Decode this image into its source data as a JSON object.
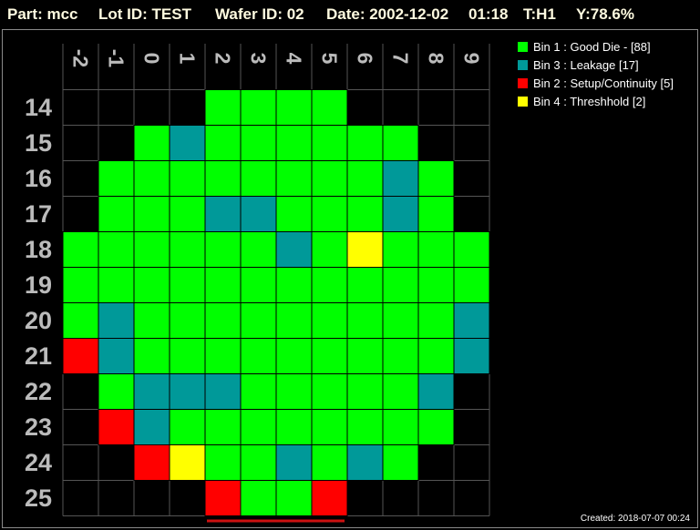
{
  "header": {
    "part": "Part: mcc",
    "lot": "Lot ID: TEST",
    "wafer": "Wafer ID: 02",
    "date": "Date: 2002-12-02",
    "time": "01:18",
    "test": "T:H1",
    "yield": "Y:78.6%"
  },
  "footer": {
    "created": "Created: 2018-07-07 00:24"
  },
  "colors": {
    "bin1": "#00ff00",
    "bin3": "#009999",
    "bin2": "#ff0000",
    "bin4": "#ffff00",
    "grid": "#555555",
    "axis_text": "#bbbbbb",
    "header_text": "#fffbe0"
  },
  "chart_data": {
    "type": "heatmap",
    "x_ticks": [
      "-2",
      "-1",
      "0",
      "1",
      "2",
      "3",
      "4",
      "5",
      "6",
      "7",
      "8",
      "9"
    ],
    "y_ticks": [
      "14",
      "15",
      "16",
      "17",
      "18",
      "19",
      "20",
      "21",
      "22",
      "23",
      "24",
      "25"
    ],
    "legend": [
      {
        "bin": 1,
        "label": "Bin 1 : Good Die - [88]",
        "color": "#00ff00"
      },
      {
        "bin": 3,
        "label": "Bin 3 : Leakage [17]",
        "color": "#009999"
      },
      {
        "bin": 2,
        "label": "Bin 2 : Setup/Continuity [5]",
        "color": "#ff0000"
      },
      {
        "bin": 4,
        "label": "Bin 4 : Threshhold [2]",
        "color": "#ffff00"
      }
    ],
    "legend_position": "top-right",
    "grid": true,
    "notch": "bottom",
    "dies": [
      {
        "x": 2,
        "y": 14,
        "bin": 1
      },
      {
        "x": 3,
        "y": 14,
        "bin": 1
      },
      {
        "x": 4,
        "y": 14,
        "bin": 1
      },
      {
        "x": 5,
        "y": 14,
        "bin": 1
      },
      {
        "x": 0,
        "y": 15,
        "bin": 1
      },
      {
        "x": 1,
        "y": 15,
        "bin": 3
      },
      {
        "x": 2,
        "y": 15,
        "bin": 1
      },
      {
        "x": 3,
        "y": 15,
        "bin": 1
      },
      {
        "x": 4,
        "y": 15,
        "bin": 1
      },
      {
        "x": 5,
        "y": 15,
        "bin": 1
      },
      {
        "x": 6,
        "y": 15,
        "bin": 1
      },
      {
        "x": 7,
        "y": 15,
        "bin": 1
      },
      {
        "x": -1,
        "y": 16,
        "bin": 1
      },
      {
        "x": 0,
        "y": 16,
        "bin": 1
      },
      {
        "x": 1,
        "y": 16,
        "bin": 1
      },
      {
        "x": 2,
        "y": 16,
        "bin": 1
      },
      {
        "x": 3,
        "y": 16,
        "bin": 1
      },
      {
        "x": 4,
        "y": 16,
        "bin": 1
      },
      {
        "x": 5,
        "y": 16,
        "bin": 1
      },
      {
        "x": 6,
        "y": 16,
        "bin": 1
      },
      {
        "x": 7,
        "y": 16,
        "bin": 3
      },
      {
        "x": 8,
        "y": 16,
        "bin": 1
      },
      {
        "x": -1,
        "y": 17,
        "bin": 1
      },
      {
        "x": 0,
        "y": 17,
        "bin": 1
      },
      {
        "x": 1,
        "y": 17,
        "bin": 1
      },
      {
        "x": 2,
        "y": 17,
        "bin": 3
      },
      {
        "x": 3,
        "y": 17,
        "bin": 3
      },
      {
        "x": 4,
        "y": 17,
        "bin": 1
      },
      {
        "x": 5,
        "y": 17,
        "bin": 1
      },
      {
        "x": 6,
        "y": 17,
        "bin": 1
      },
      {
        "x": 7,
        "y": 17,
        "bin": 3
      },
      {
        "x": 8,
        "y": 17,
        "bin": 1
      },
      {
        "x": -2,
        "y": 18,
        "bin": 1
      },
      {
        "x": -1,
        "y": 18,
        "bin": 1
      },
      {
        "x": 0,
        "y": 18,
        "bin": 1
      },
      {
        "x": 1,
        "y": 18,
        "bin": 1
      },
      {
        "x": 2,
        "y": 18,
        "bin": 1
      },
      {
        "x": 3,
        "y": 18,
        "bin": 1
      },
      {
        "x": 4,
        "y": 18,
        "bin": 3
      },
      {
        "x": 5,
        "y": 18,
        "bin": 1
      },
      {
        "x": 6,
        "y": 18,
        "bin": 4
      },
      {
        "x": 7,
        "y": 18,
        "bin": 1
      },
      {
        "x": 8,
        "y": 18,
        "bin": 1
      },
      {
        "x": 9,
        "y": 18,
        "bin": 1
      },
      {
        "x": -2,
        "y": 19,
        "bin": 1
      },
      {
        "x": -1,
        "y": 19,
        "bin": 1
      },
      {
        "x": 0,
        "y": 19,
        "bin": 1
      },
      {
        "x": 1,
        "y": 19,
        "bin": 1
      },
      {
        "x": 2,
        "y": 19,
        "bin": 1
      },
      {
        "x": 3,
        "y": 19,
        "bin": 1
      },
      {
        "x": 4,
        "y": 19,
        "bin": 1
      },
      {
        "x": 5,
        "y": 19,
        "bin": 1
      },
      {
        "x": 6,
        "y": 19,
        "bin": 1
      },
      {
        "x": 7,
        "y": 19,
        "bin": 1
      },
      {
        "x": 8,
        "y": 19,
        "bin": 1
      },
      {
        "x": 9,
        "y": 19,
        "bin": 1
      },
      {
        "x": -2,
        "y": 20,
        "bin": 1
      },
      {
        "x": -1,
        "y": 20,
        "bin": 3
      },
      {
        "x": 0,
        "y": 20,
        "bin": 1
      },
      {
        "x": 1,
        "y": 20,
        "bin": 1
      },
      {
        "x": 2,
        "y": 20,
        "bin": 1
      },
      {
        "x": 3,
        "y": 20,
        "bin": 1
      },
      {
        "x": 4,
        "y": 20,
        "bin": 1
      },
      {
        "x": 5,
        "y": 20,
        "bin": 1
      },
      {
        "x": 6,
        "y": 20,
        "bin": 1
      },
      {
        "x": 7,
        "y": 20,
        "bin": 1
      },
      {
        "x": 8,
        "y": 20,
        "bin": 1
      },
      {
        "x": 9,
        "y": 20,
        "bin": 3
      },
      {
        "x": -2,
        "y": 21,
        "bin": 2
      },
      {
        "x": -1,
        "y": 21,
        "bin": 3
      },
      {
        "x": 0,
        "y": 21,
        "bin": 1
      },
      {
        "x": 1,
        "y": 21,
        "bin": 1
      },
      {
        "x": 2,
        "y": 21,
        "bin": 1
      },
      {
        "x": 3,
        "y": 21,
        "bin": 1
      },
      {
        "x": 4,
        "y": 21,
        "bin": 1
      },
      {
        "x": 5,
        "y": 21,
        "bin": 1
      },
      {
        "x": 6,
        "y": 21,
        "bin": 1
      },
      {
        "x": 7,
        "y": 21,
        "bin": 1
      },
      {
        "x": 8,
        "y": 21,
        "bin": 1
      },
      {
        "x": 9,
        "y": 21,
        "bin": 3
      },
      {
        "x": -1,
        "y": 22,
        "bin": 1
      },
      {
        "x": 0,
        "y": 22,
        "bin": 3
      },
      {
        "x": 1,
        "y": 22,
        "bin": 3
      },
      {
        "x": 2,
        "y": 22,
        "bin": 3
      },
      {
        "x": 3,
        "y": 22,
        "bin": 1
      },
      {
        "x": 4,
        "y": 22,
        "bin": 1
      },
      {
        "x": 5,
        "y": 22,
        "bin": 1
      },
      {
        "x": 6,
        "y": 22,
        "bin": 1
      },
      {
        "x": 7,
        "y": 22,
        "bin": 1
      },
      {
        "x": 8,
        "y": 22,
        "bin": 3
      },
      {
        "x": -1,
        "y": 23,
        "bin": 2
      },
      {
        "x": 0,
        "y": 23,
        "bin": 3
      },
      {
        "x": 1,
        "y": 23,
        "bin": 1
      },
      {
        "x": 2,
        "y": 23,
        "bin": 1
      },
      {
        "x": 3,
        "y": 23,
        "bin": 1
      },
      {
        "x": 4,
        "y": 23,
        "bin": 1
      },
      {
        "x": 5,
        "y": 23,
        "bin": 1
      },
      {
        "x": 6,
        "y": 23,
        "bin": 1
      },
      {
        "x": 7,
        "y": 23,
        "bin": 1
      },
      {
        "x": 8,
        "y": 23,
        "bin": 1
      },
      {
        "x": 0,
        "y": 24,
        "bin": 2
      },
      {
        "x": 1,
        "y": 24,
        "bin": 4
      },
      {
        "x": 2,
        "y": 24,
        "bin": 1
      },
      {
        "x": 3,
        "y": 24,
        "bin": 1
      },
      {
        "x": 4,
        "y": 24,
        "bin": 3
      },
      {
        "x": 5,
        "y": 24,
        "bin": 1
      },
      {
        "x": 6,
        "y": 24,
        "bin": 3
      },
      {
        "x": 7,
        "y": 24,
        "bin": 1
      },
      {
        "x": 2,
        "y": 25,
        "bin": 2
      },
      {
        "x": 3,
        "y": 25,
        "bin": 1
      },
      {
        "x": 4,
        "y": 25,
        "bin": 1
      },
      {
        "x": 5,
        "y": 25,
        "bin": 2
      }
    ]
  }
}
